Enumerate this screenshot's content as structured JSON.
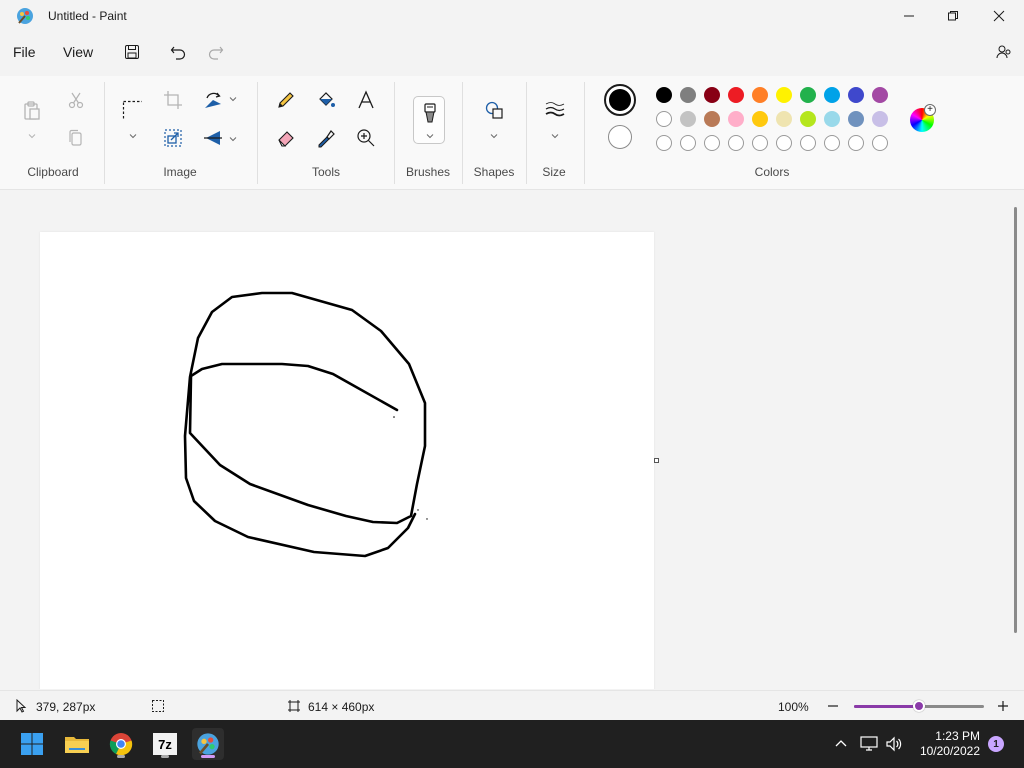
{
  "window": {
    "title": "Untitled - Paint"
  },
  "menu": {
    "file": "File",
    "view": "View"
  },
  "ribbon": {
    "groups": {
      "clipboard": "Clipboard",
      "image": "Image",
      "tools": "Tools",
      "brushes": "Brushes",
      "shapes": "Shapes",
      "size": "Size",
      "colors": "Colors"
    },
    "primary_color": "#000000",
    "secondary_color": "#ffffff",
    "palette_row1": [
      "#000000",
      "#7f7f7f",
      "#880015",
      "#ed1c24",
      "#ff7f27",
      "#fff200",
      "#22b14c",
      "#00a2e8",
      "#3f48cc",
      "#a349a4"
    ],
    "palette_row2": [
      "#ffffff",
      "#c3c3c3",
      "#b97a57",
      "#ffaec9",
      "#ffc90e",
      "#efe4b0",
      "#b5e61d",
      "#99d9ea",
      "#7092be",
      "#c8bfe7"
    ],
    "palette_row3_count_label": "custom slots"
  },
  "status": {
    "cursor_position": "379, 287px",
    "canvas_size": "614 × 460px",
    "zoom": "100%",
    "zoom_level": 0.5
  },
  "taskbar": {
    "time": "1:23 PM",
    "date": "10/20/2022",
    "notification_count": "1"
  }
}
